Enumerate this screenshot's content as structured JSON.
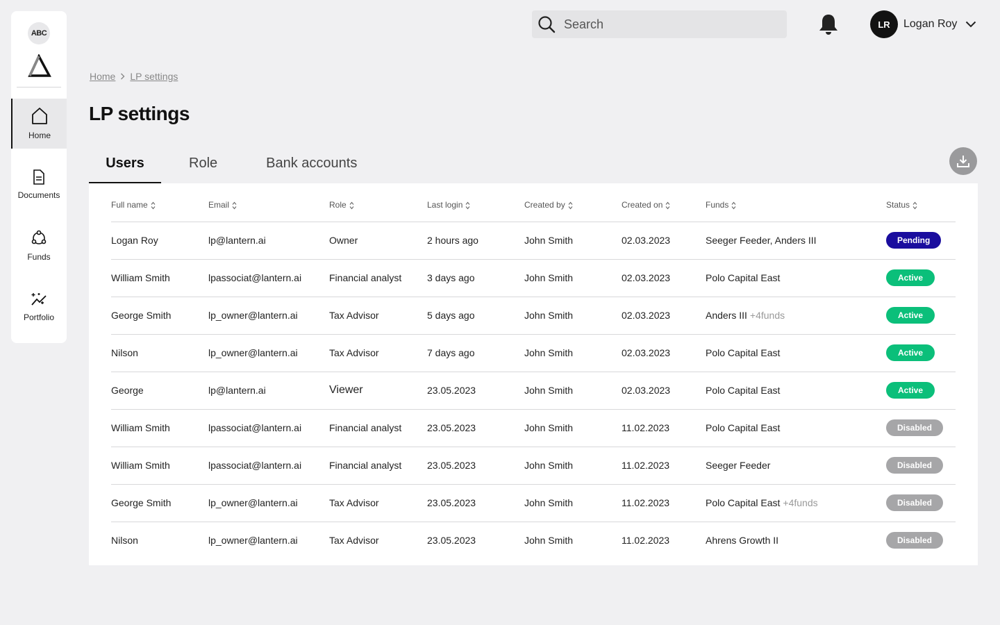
{
  "sidebar": {
    "badge": "ABC",
    "items": [
      {
        "label": "Home",
        "icon": "home-icon",
        "active": true
      },
      {
        "label": "Documents",
        "icon": "document-icon",
        "active": false
      },
      {
        "label": "Funds",
        "icon": "funds-icon",
        "active": false
      },
      {
        "label": "Portfolio",
        "icon": "portfolio-icon",
        "active": false
      }
    ]
  },
  "header": {
    "search_placeholder": "Search",
    "user_initials": "LR",
    "user_name": "Logan Roy"
  },
  "breadcrumb": [
    "Home",
    "LP settings"
  ],
  "page_title": "LP settings",
  "tabs": [
    "Users",
    "Role",
    "Bank accounts"
  ],
  "table": {
    "columns": [
      "Full name",
      "Email",
      "Role",
      "Last login",
      "Created by",
      "Created on",
      "Funds",
      "Status"
    ],
    "rows": [
      {
        "name": "Logan  Roy",
        "email": "lp@lantern.ai",
        "role": "Owner",
        "last_login": "2 hours ago",
        "created_by": "John Smith",
        "created_on": "02.03.2023",
        "funds": "Seeger Feeder, Anders III",
        "funds_more": "",
        "status": "Pending"
      },
      {
        "name": "William Smith",
        "email": "lpassociat@lantern.ai",
        "role": "Financial analyst",
        "last_login": "3 days ago",
        "created_by": "John Smith",
        "created_on": "02.03.2023",
        "funds": "Polo Capital East",
        "funds_more": "",
        "status": "Active"
      },
      {
        "name": "George Smith",
        "email": "lp_owner@lantern.ai",
        "role": "Tax Advisor",
        "last_login": "5 days ago",
        "created_by": "John Smith",
        "created_on": "02.03.2023",
        "funds": "Anders III",
        "funds_more": "+4funds",
        "status": "Active"
      },
      {
        "name": "Nilson",
        "email": "lp_owner@lantern.ai",
        "role": "Tax Advisor",
        "last_login": "7 days ago",
        "created_by": "John Smith",
        "created_on": "02.03.2023",
        "funds": "Polo Capital East",
        "funds_more": "",
        "status": "Active"
      },
      {
        "name": "George",
        "email": "lp@lantern.ai",
        "role": "Viewer",
        "last_login": "23.05.2023",
        "created_by": "John Smith",
        "created_on": "02.03.2023",
        "funds": "Polo Capital East",
        "funds_more": "",
        "status": "Active"
      },
      {
        "name": "William Smith",
        "email": "lpassociat@lantern.ai",
        "role": "Financial analyst",
        "last_login": "23.05.2023",
        "created_by": "John Smith",
        "created_on": "11.02.2023",
        "funds": "Polo Capital East",
        "funds_more": "",
        "status": "Disabled"
      },
      {
        "name": "William Smith",
        "email": "lpassociat@lantern.ai",
        "role": "Financial analyst",
        "last_login": "23.05.2023",
        "created_by": "John Smith",
        "created_on": "11.02.2023",
        "funds": "Seeger Feeder",
        "funds_more": "",
        "status": "Disabled"
      },
      {
        "name": "George Smith",
        "email": "lp_owner@lantern.ai",
        "role": "Tax Advisor",
        "last_login": "23.05.2023",
        "created_by": "John Smith",
        "created_on": "11.02.2023",
        "funds": "Polo Capital East",
        "funds_more": "+4funds",
        "status": "Disabled"
      },
      {
        "name": "Nilson",
        "email": "lp_owner@lantern.ai",
        "role": "Tax Advisor",
        "last_login": "23.05.2023",
        "created_by": "John Smith",
        "created_on": "11.02.2023",
        "funds": "Ahrens Growth II",
        "funds_more": "",
        "status": "Disabled"
      }
    ]
  },
  "colors": {
    "pending": "#1a0d9e",
    "active": "#0bbf7a",
    "disabled": "#a6a6a8",
    "background": "#f0f0f2"
  }
}
